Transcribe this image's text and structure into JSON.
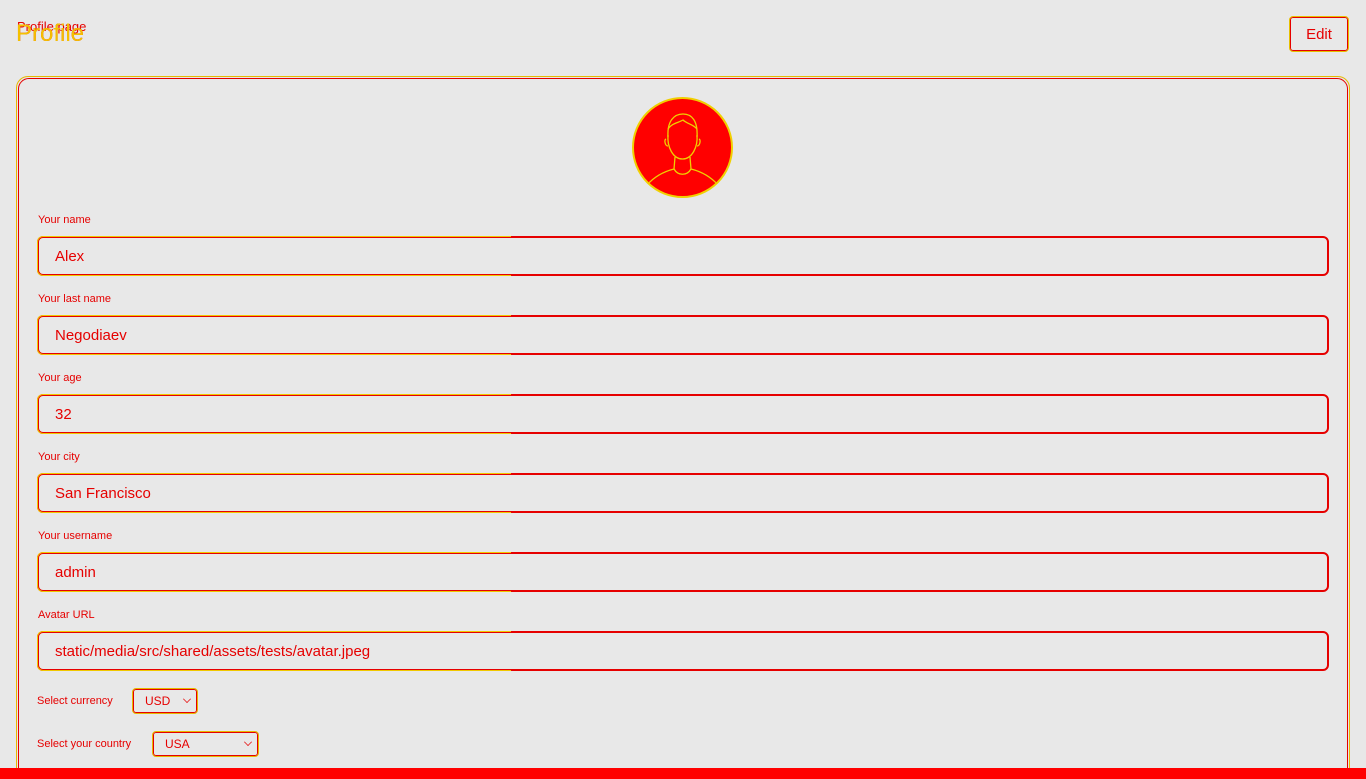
{
  "header": {
    "breadcrumb": "Profile page",
    "title": "Profile",
    "edit_label": "Edit"
  },
  "avatar": {
    "icon": "user-avatar-icon"
  },
  "fields": [
    {
      "label": "Your name",
      "value": "Alex"
    },
    {
      "label": "Your last name",
      "value": "Negodiaev"
    },
    {
      "label": "Your age",
      "value": "32"
    },
    {
      "label": "Your city",
      "value": "San Francisco"
    },
    {
      "label": "Your username",
      "value": "admin"
    },
    {
      "label": "Avatar URL",
      "value": "static/media/src/shared/assets/tests/avatar.jpeg"
    }
  ],
  "currency": {
    "label": "Select currency",
    "value": "USD"
  },
  "country": {
    "label": "Select your country",
    "value": "USA"
  },
  "colors": {
    "accent": "#e60000",
    "secondary": "#f0c800",
    "background": "#e8e8e8"
  }
}
